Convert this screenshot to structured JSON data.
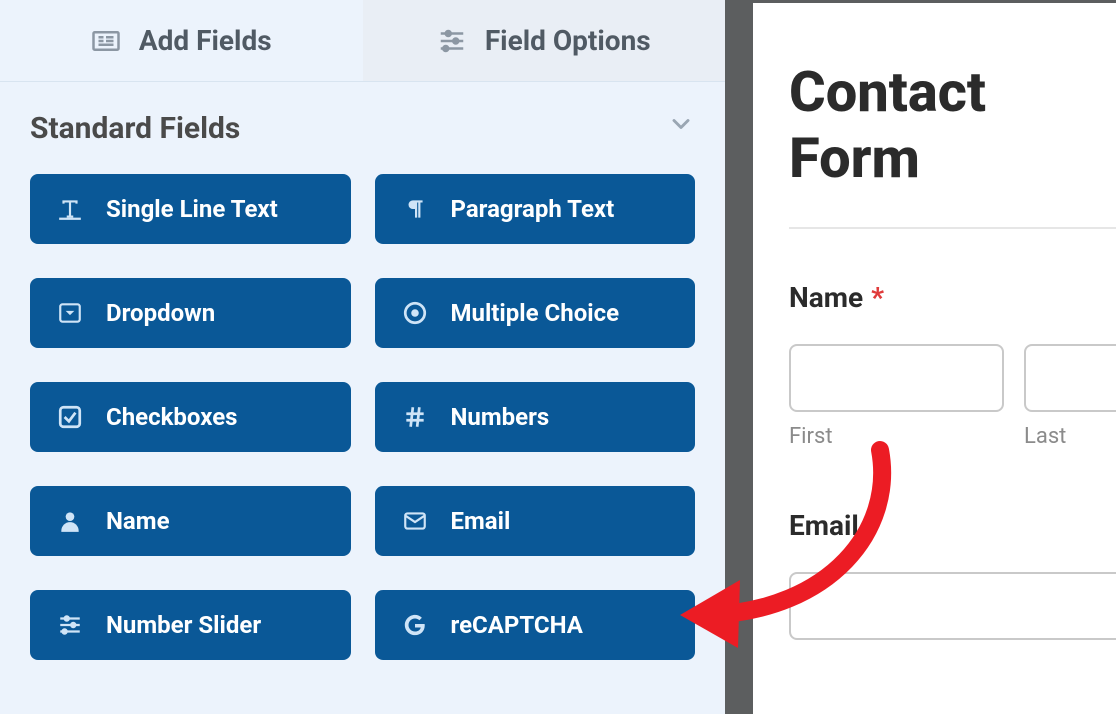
{
  "tabs": {
    "add": "Add Fields",
    "options": "Field Options"
  },
  "section": {
    "title": "Standard Fields"
  },
  "fields": {
    "single_line": "Single Line Text",
    "paragraph": "Paragraph Text",
    "dropdown": "Dropdown",
    "multiple": "Multiple Choice",
    "checkboxes": "Checkboxes",
    "numbers": "Numbers",
    "name": "Name",
    "email": "Email",
    "slider": "Number Slider",
    "recaptcha": "reCAPTCHA"
  },
  "preview": {
    "title": "Contact Form",
    "name_label": "Name",
    "required": "*",
    "first": "First",
    "last": "Last",
    "email_label": "Email"
  }
}
